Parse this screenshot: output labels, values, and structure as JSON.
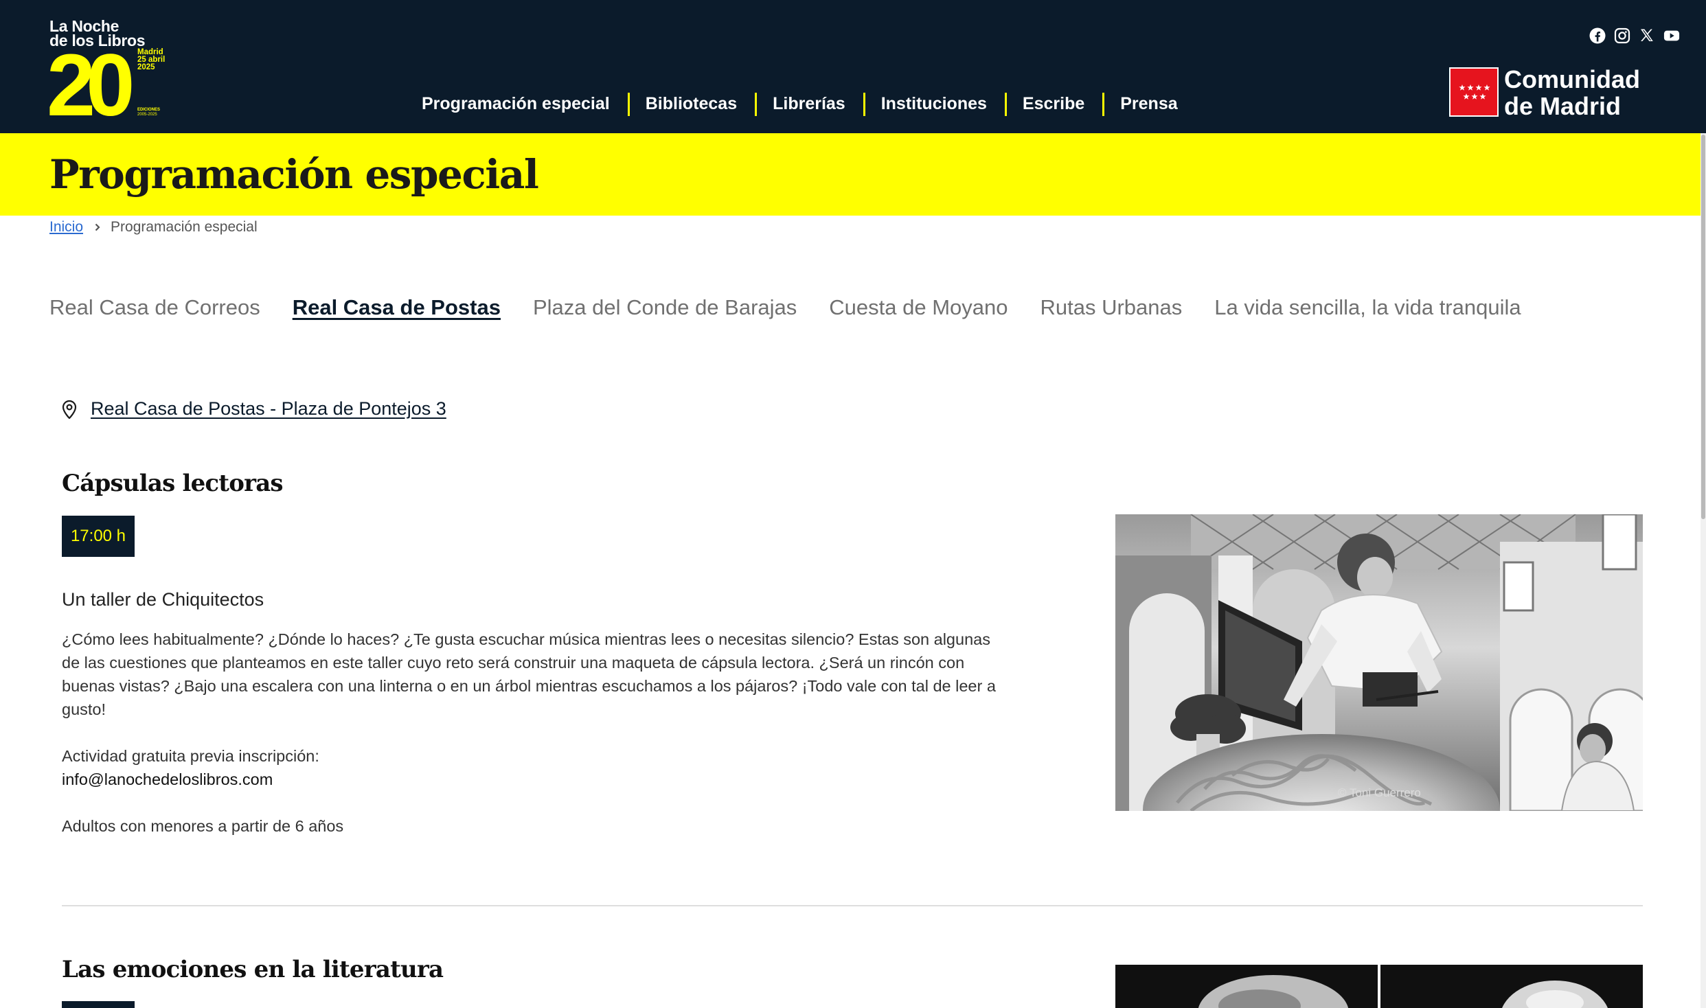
{
  "header": {
    "logo": {
      "line1": "La Noche",
      "line2": "de los Libros",
      "number": "20",
      "city": "Madrid",
      "date": "25 abril",
      "year": "2025",
      "editions_label": "EDICIONES",
      "editions_years": "2005-2025"
    },
    "nav": [
      {
        "label": "Programación especial"
      },
      {
        "label": "Bibliotecas"
      },
      {
        "label": "Librerías"
      },
      {
        "label": "Instituciones"
      },
      {
        "label": "Escribe"
      },
      {
        "label": "Prensa"
      }
    ],
    "social": [
      "facebook-icon",
      "instagram-icon",
      "x-icon",
      "youtube-icon"
    ],
    "partner": {
      "line1": "Comunidad",
      "line2": "de Madrid"
    },
    "colors": {
      "header_bg": "#0b1b2b",
      "accent": "#ffff00",
      "partner_red": "#e6141e"
    }
  },
  "banner": {
    "title": "Programación especial"
  },
  "breadcrumb": {
    "home": "Inicio",
    "separator": "›",
    "current": "Programación especial"
  },
  "tabs": [
    {
      "label": "Real Casa de Correos",
      "active": false
    },
    {
      "label": "Real Casa de Postas",
      "active": true
    },
    {
      "label": "Plaza del Conde de Barajas",
      "active": false
    },
    {
      "label": "Cuesta de Moyano",
      "active": false
    },
    {
      "label": "Rutas Urbanas",
      "active": false
    },
    {
      "label": "La vida sencilla, la vida tranquila",
      "active": false
    }
  ],
  "location": {
    "icon": "map-pin-icon",
    "label": "Real Casa de Postas - Plaza de Pontejos 3"
  },
  "events": [
    {
      "title": "Cápsulas lectoras",
      "time": "17:00 h",
      "subtitle": "Un taller de Chiquitectos",
      "description": "¿Cómo lees habitualmente? ¿Dónde lo haces? ¿Te gusta escuchar música mientras lees o necesitas silencio? Estas son algunas de las cuestiones que planteamos en este taller cuyo reto será construir una maqueta de cápsula lectora. ¿Será un rincón con buenas vistas? ¿Bajo una escalera con una linterna o en un árbol mientras escuchamos a los pájaros? ¡Todo vale con tal de leer a gusto!",
      "registration": "Actividad gratuita previa inscripción:",
      "email": "info@lanochedeloslibros.com",
      "audience": "Adultos con menores a partir de 6 años",
      "photo_credit": "© Toni Guerrero"
    },
    {
      "title": "Las emociones en la literatura"
    }
  ]
}
